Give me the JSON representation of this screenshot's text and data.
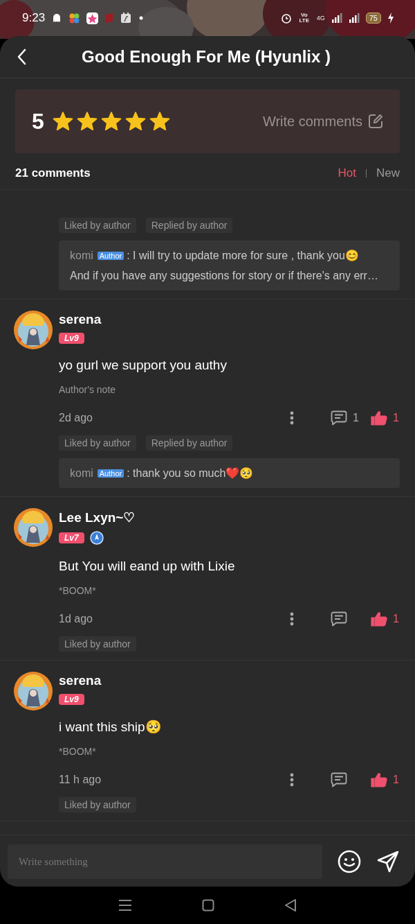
{
  "status_bar": {
    "time": "9:23",
    "network_label": "Vo LTE",
    "network_type": "4G",
    "battery": "75"
  },
  "header": {
    "title": "Good Enough For Me (Hyunlix )"
  },
  "rating": {
    "score": "5",
    "stars": 5,
    "write_label": "Write comments"
  },
  "comments_header": {
    "count": "21 comments",
    "sort_tabs": [
      {
        "label": "Hot",
        "selected": true
      },
      {
        "label": "New",
        "selected": false
      }
    ]
  },
  "comments": [
    {
      "kind": "partial",
      "tags": [
        "Liked by author",
        "Replied by author"
      ],
      "reply": {
        "name": "komi",
        "badge": "Author",
        "lines": [
          ": I will try to update more for sure , thank you😊",
          "And if you have any suggestions for story or if there's any err…"
        ]
      }
    },
    {
      "kind": "full",
      "name": "serena",
      "level": "Lv9",
      "writer_badge": false,
      "text": "yo gurl we support you authy",
      "note": "Author's note",
      "time": "2d ago",
      "reply_count": "1",
      "likes": "1",
      "liked": true,
      "tags": [
        "Liked by author",
        "Replied by author"
      ],
      "reply": {
        "name": "komi",
        "badge": "Author",
        "lines": [
          ": thank you so much❤️🥺"
        ]
      }
    },
    {
      "kind": "full",
      "name": "Lee Lxyn~♡",
      "level": "Lv7",
      "writer_badge": true,
      "text": "But You will eand up with Lixie",
      "note": "*BOOM*",
      "time": "1d ago",
      "likes": "1",
      "liked": true,
      "tags": [
        "Liked by author"
      ]
    },
    {
      "kind": "full",
      "name": "serena",
      "level": "Lv9",
      "writer_badge": false,
      "text": "i want this ship🥺",
      "note": "*BOOM*",
      "time": "11 h ago",
      "likes": "1",
      "liked": true,
      "tags": [
        "Liked by author"
      ]
    }
  ],
  "composer": {
    "placeholder": "Write something"
  }
}
